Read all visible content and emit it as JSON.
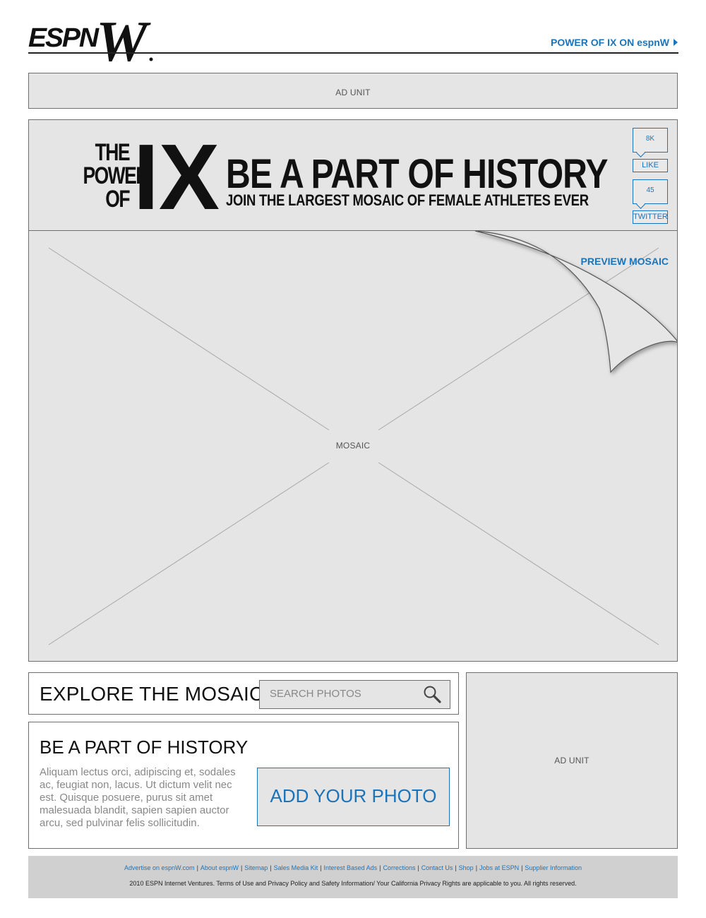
{
  "header": {
    "logo_text": "ESPN",
    "logo_w": "W",
    "power_link": "POWER OF IX ON espnW"
  },
  "top_ad": {
    "label": "AD UNIT"
  },
  "banner": {
    "side_text": [
      "THE",
      "POWER",
      "OF"
    ],
    "ix_text": "IX",
    "headline": "BE A PART OF HISTORY",
    "subhead": "JOIN THE LARGEST  MOSAIC OF FEMALE ATHLETES EVER",
    "like_count": "8K",
    "like_label": "LIKE",
    "twitter_count": "45",
    "twitter_label": "TWITTER"
  },
  "mosaic": {
    "label": "MOSAIC",
    "preview_link": "PREVIEW MOSAIC"
  },
  "explore": {
    "title": "EXPLORE THE MOSAIC",
    "search_placeholder": "SEARCH PHOTOS"
  },
  "history": {
    "title": "BE A PART OF HISTORY",
    "body": "Aliquam lectus orci, adipiscing et, sodales ac, feugiat non, lacus. Ut dictum velit nec est. Quisque posuere, purus sit amet malesuada blandit, sapien sapien auctor arcu, sed pulvinar felis sollicitudin.",
    "button": "ADD YOUR PHOTO"
  },
  "side_ad": {
    "label": "AD UNIT"
  },
  "footer": {
    "links": [
      "Advertise on espnW.com",
      "About espnW",
      "Sitemap",
      "Sales Media Kit",
      "Interest Based Ads",
      "Corrections",
      "Contact Us",
      "Shop",
      "Jobs at ESPN",
      "Supplier Information"
    ],
    "copyright": "2010 ESPN Internet Ventures. Terms of Use and Privacy Policy and Safety Information/ Your California Privacy Rights are applicable to you. All rights reserved."
  },
  "colors": {
    "accent": "#1b74b9",
    "panel": "#e5e5e5",
    "footer": "#d0d0d0"
  }
}
